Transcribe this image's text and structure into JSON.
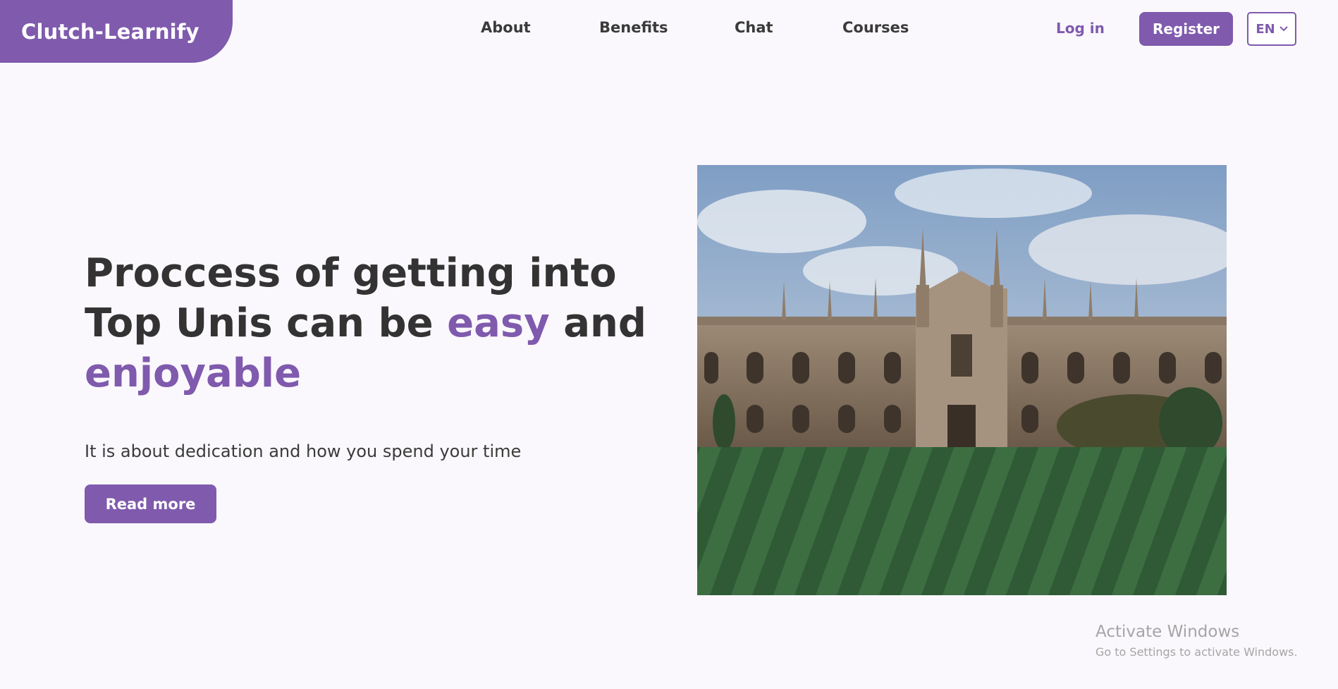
{
  "brand": {
    "name": "Clutch-Learnify",
    "color": "#7f5aad"
  },
  "nav": {
    "links": [
      {
        "label": "About"
      },
      {
        "label": "Benefits"
      },
      {
        "label": "Chat"
      },
      {
        "label": "Courses"
      }
    ],
    "login_label": "Log in",
    "register_label": "Register",
    "language": "EN"
  },
  "hero": {
    "title_part1": "Proccess of getting into Top Unis can be ",
    "title_accent1": "easy",
    "title_part2": " and ",
    "title_accent2": "enjoyable",
    "subtitle": "It is about dedication and how you spend your time",
    "cta_label": "Read more",
    "image_icon": "university-building-image"
  },
  "os_watermark": {
    "title": "Activate Windows",
    "subtitle": "Go to Settings to activate Windows."
  },
  "colors": {
    "accent": "#7f5aad",
    "background": "#fbf8fd",
    "text": "#333333"
  }
}
